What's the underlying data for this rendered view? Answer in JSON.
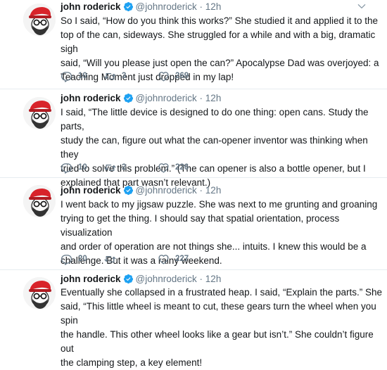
{
  "tweets": [
    {
      "name": "john roderick",
      "handle": "@johnroderick",
      "dot": "·",
      "time": "12h",
      "lines": [
        "So I said, “How do you think this works?” She studied it and applied it to the",
        "top of the can, sideways. She struggled for a while and with a big, dramatic sigh",
        "said, “Will you please just open the can?” Apocalypse Dad was overjoyed: a",
        "Teaching Moment just dropped in my lap!"
      ],
      "replies": "10",
      "retweets": "3",
      "likes": "269"
    },
    {
      "name": "john roderick",
      "handle": "@johnroderick",
      "dot": "·",
      "time": "12h",
      "lines": [
        "I said, “The little device is designed to do one thing: open cans. Study the parts,",
        "study the can, figure out what the can-opener inventor was thinking when they",
        "tried to solve this problem.” (The can opener is also a bottle opener, but I",
        "explained that part wasn’t relevant.)"
      ],
      "replies": "10",
      "retweets": "2",
      "likes": "226"
    },
    {
      "name": "john roderick",
      "handle": "@johnroderick",
      "dot": "·",
      "time": "12h",
      "lines": [
        "I went back to my jigsaw puzzle. She was next to me grunting and groaning",
        "trying to get the thing. I should say that spatial orientation, process visualization",
        "and order of operation are not things she... intuits. I knew this would be a",
        "challenge. But it was a rainy weekend."
      ],
      "replies": "20",
      "retweets": "",
      "likes": "227"
    },
    {
      "name": "john roderick",
      "handle": "@johnroderick",
      "dot": "·",
      "time": "12h",
      "lines": [
        "Eventually she collapsed in a frustrated heap. I said, “Explain the parts.” She",
        "said, “This little wheel is meant to cut, these gears turn the wheel when you spin",
        "the handle. This other wheel looks like a gear but isn’t.” She couldn’t figure out",
        "the clamping step, a key element!"
      ],
      "replies": "",
      "retweets": "",
      "likes": ""
    }
  ],
  "icons": {
    "verified": "verified-badge-icon",
    "chevron": "chevron-down-icon",
    "reply": "reply-icon",
    "retweet": "retweet-icon",
    "like": "heart-icon"
  },
  "colors": {
    "accent": "#1da1f2",
    "text": "#14171a",
    "muted": "#657786",
    "separator": "#e6ecf0",
    "avatar_hat": "#d8232a"
  }
}
